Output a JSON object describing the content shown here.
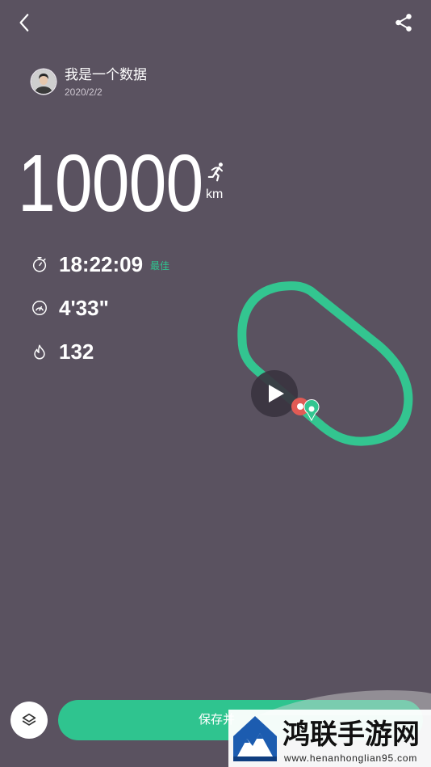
{
  "header": {
    "back_icon": "chevron-left-icon",
    "share_icon": "share-icon"
  },
  "user": {
    "name": "我是一个数据",
    "date": "2020/2/2"
  },
  "distance": {
    "value": "10000",
    "unit": "km",
    "icon": "running-person-icon"
  },
  "stats": [
    {
      "icon": "stopwatch-icon",
      "value": "18:22:09",
      "badge": "最佳"
    },
    {
      "icon": "speedometer-icon",
      "value": "4'33\""
    },
    {
      "icon": "flame-icon",
      "value": "132"
    }
  ],
  "map": {
    "route_color": "#33c590",
    "play_icon": "play-icon",
    "start_marker_color": "#e15b55",
    "end_marker_color": "#33c590"
  },
  "footer": {
    "layers_icon": "layers-icon",
    "save_label": "保存并"
  },
  "watermark": {
    "name": "鸿联手游网",
    "url": "www.henanhonglian95.com"
  },
  "colors": {
    "background": "#5a5260",
    "accent": "#2fc48f",
    "text": "#ffffff",
    "muted_text": "#cdc6d0"
  }
}
